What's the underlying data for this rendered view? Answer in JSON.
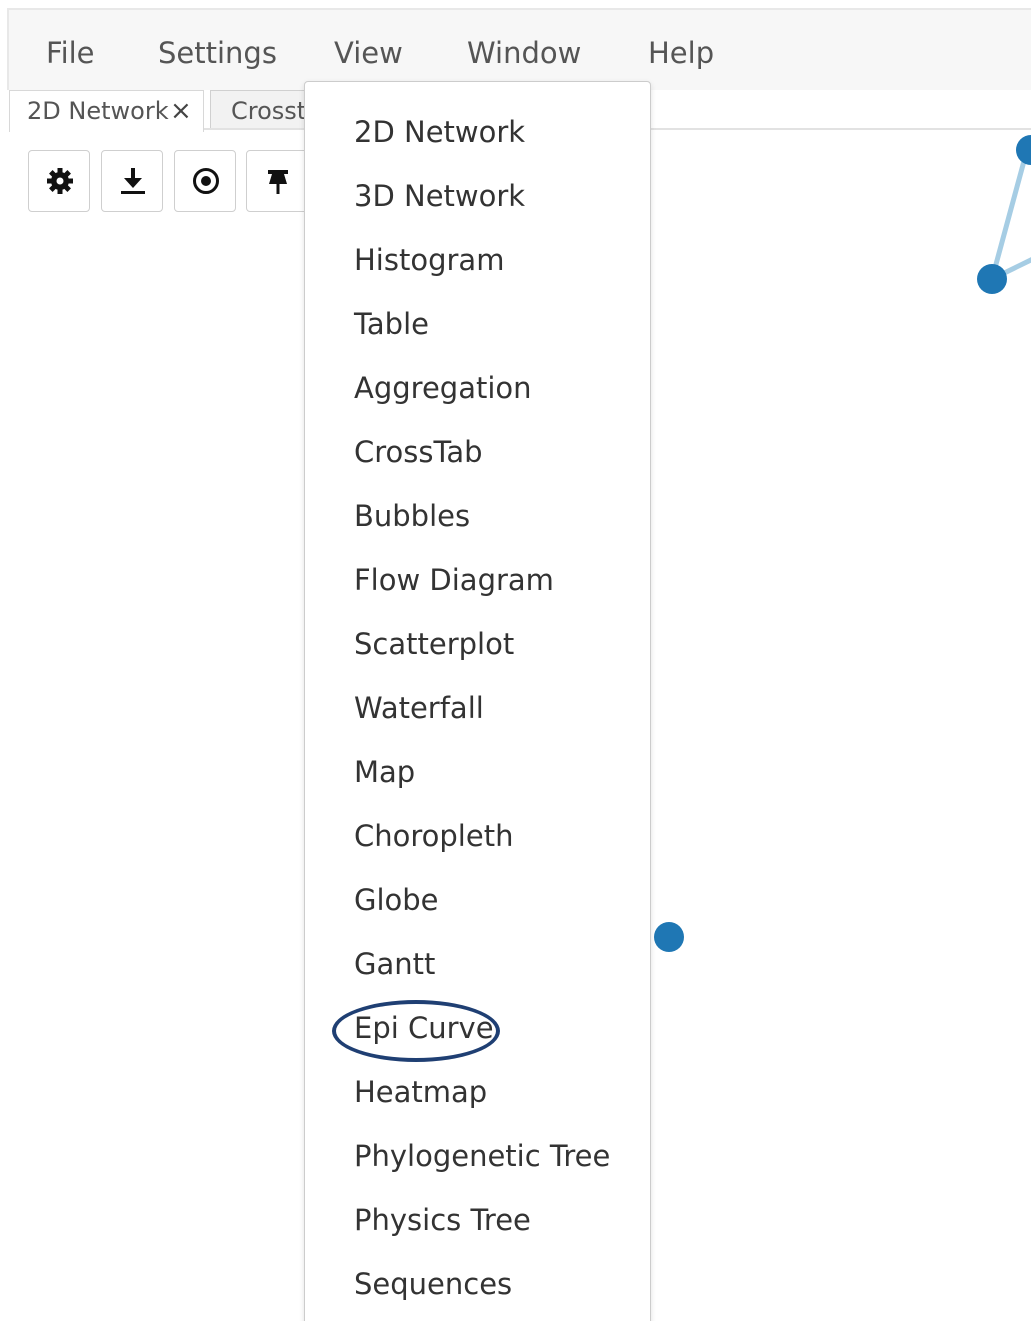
{
  "menubar": {
    "items": [
      {
        "label": "File"
      },
      {
        "label": "Settings"
      },
      {
        "label": "View"
      },
      {
        "label": "Window"
      },
      {
        "label": "Help"
      }
    ]
  },
  "tabs": [
    {
      "label": "2D Network",
      "close": "×",
      "active": true
    },
    {
      "label": "Crossta",
      "active": false
    }
  ],
  "toolbar": {
    "buttons": [
      {
        "icon": "gear-icon"
      },
      {
        "icon": "download-icon"
      },
      {
        "icon": "target-icon"
      },
      {
        "icon": "pin-icon"
      }
    ]
  },
  "view_menu": {
    "items": [
      {
        "label": "2D Network"
      },
      {
        "label": "3D Network"
      },
      {
        "label": "Histogram"
      },
      {
        "label": "Table"
      },
      {
        "label": "Aggregation"
      },
      {
        "label": "CrossTab"
      },
      {
        "label": "Bubbles"
      },
      {
        "label": "Flow Diagram"
      },
      {
        "label": "Scatterplot"
      },
      {
        "label": "Waterfall"
      },
      {
        "label": "Map"
      },
      {
        "label": "Choropleth"
      },
      {
        "label": "Globe"
      },
      {
        "label": "Gantt"
      },
      {
        "label": "Epi Curve",
        "highlighted": true
      },
      {
        "label": "Heatmap"
      },
      {
        "label": "Phylogenetic Tree"
      },
      {
        "label": "Physics Tree"
      },
      {
        "label": "Sequences"
      }
    ]
  },
  "colors": {
    "node": "#1f77b4",
    "edge": "#a6cde4",
    "highlight": "#1f3f73"
  }
}
